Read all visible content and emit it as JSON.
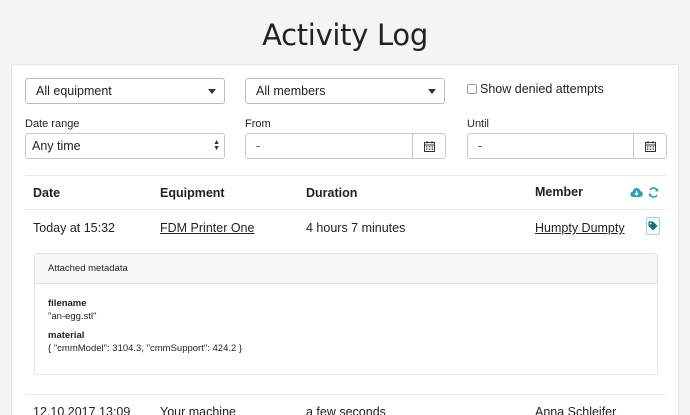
{
  "page": {
    "title": "Activity Log"
  },
  "filters": {
    "equipment_select": "All equipment",
    "members_select": "All members",
    "show_denied_label": "Show denied attempts",
    "date_range_label": "Date range",
    "date_range_value": "Any time",
    "from_label": "From",
    "from_value": "-",
    "until_label": "Until",
    "until_value": "-"
  },
  "table": {
    "headers": {
      "date": "Date",
      "equipment": "Equipment",
      "duration": "Duration",
      "member": "Member"
    },
    "rows": [
      {
        "date": "Today at 15:32",
        "equipment": "FDM Printer One",
        "duration": "4 hours 7 minutes",
        "member": "Humpty Dumpty"
      },
      {
        "date": "12.10.2017 13:09",
        "equipment": "Your machine",
        "duration": "a few seconds",
        "member": "Anna Schleifer"
      }
    ]
  },
  "metadata": {
    "title": "Attached metadata",
    "entries": [
      {
        "key": "filename",
        "value": "\"an-egg.stl\""
      },
      {
        "key": "material",
        "value": "{ \"cmmModel\": 3104.3, \"cmmSupport\": 424.2 }"
      }
    ]
  },
  "icons": {
    "cloud_download": "cloud-download-icon",
    "refresh": "refresh-icon",
    "tag": "tag-icon",
    "calendar": "calendar-icon"
  },
  "colors": {
    "accent": "#2aa3b5",
    "background": "#f3f4f6",
    "card": "#ffffff"
  }
}
